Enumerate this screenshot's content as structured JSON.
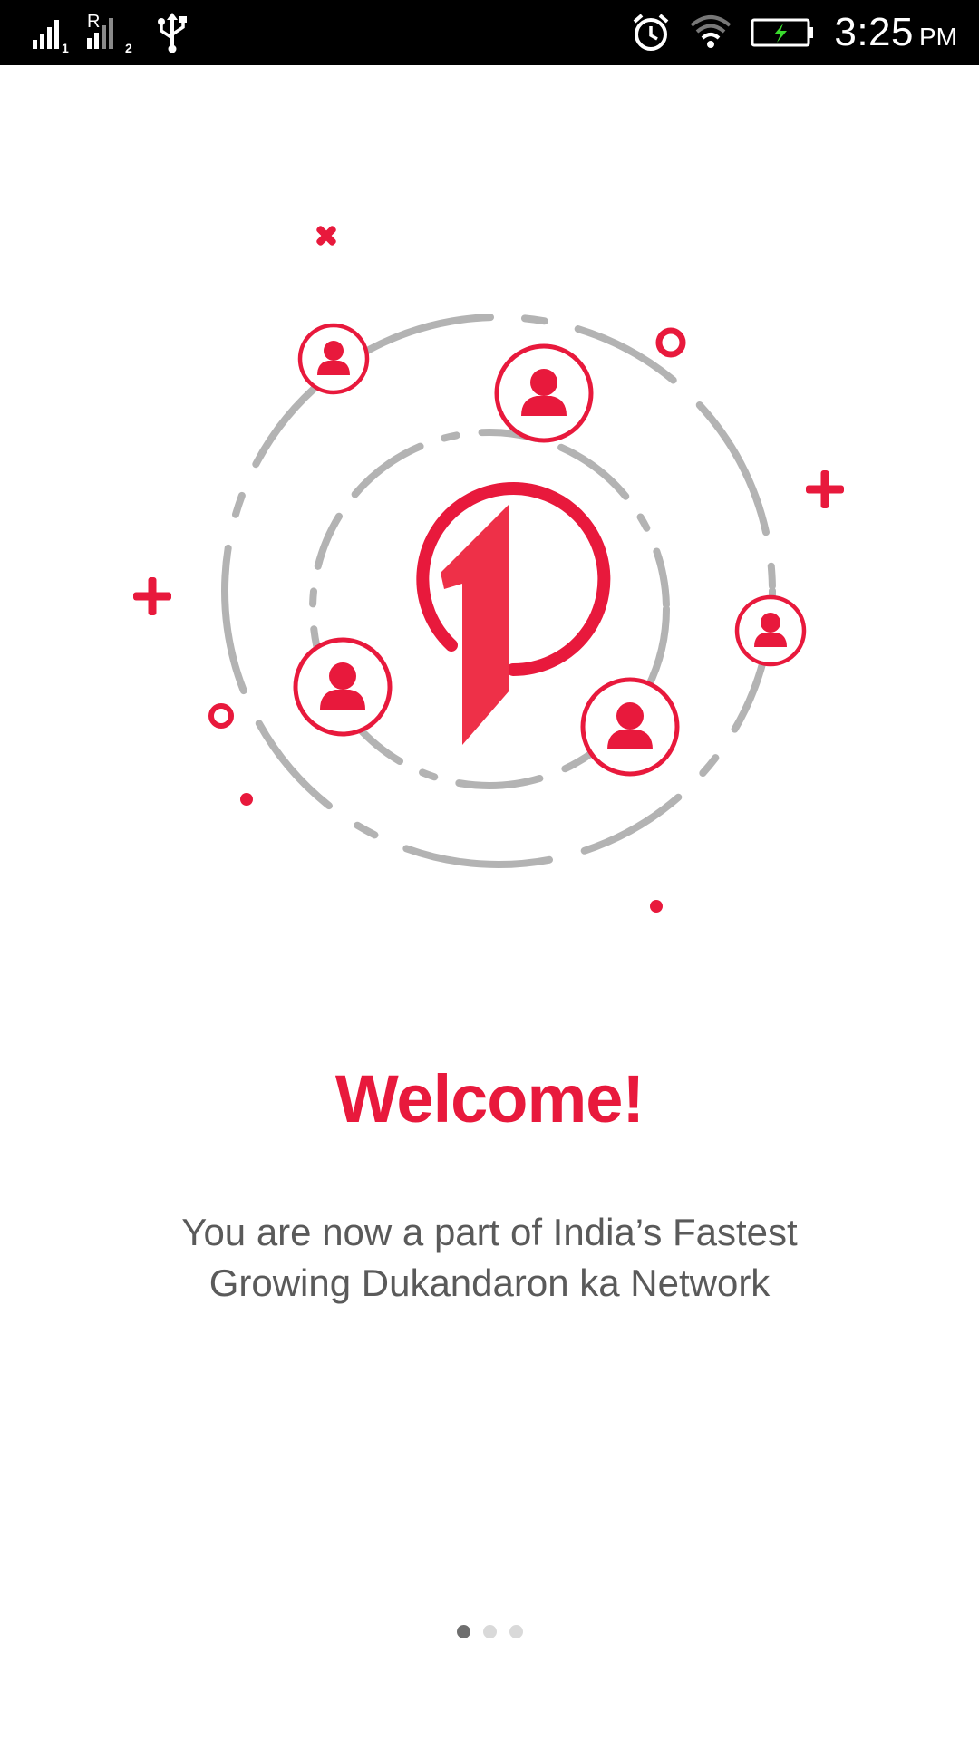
{
  "status_bar": {
    "time": "3:25",
    "ampm": "PM",
    "sim1_label": "1",
    "sim2_roaming": "R",
    "sim2_label": "2",
    "icons": [
      "signal-icon",
      "signal-roaming-icon",
      "usb-icon",
      "alarm-icon",
      "wifi-icon",
      "battery-charging-icon"
    ]
  },
  "illustration": {
    "icons": [
      "network-illustration",
      "logo-icon",
      "user-icon",
      "plus-icon",
      "cross-icon",
      "ring-icon",
      "dot-icon"
    ]
  },
  "welcome": {
    "title": "Welcome!",
    "subtitle_line1": "You are now a part of India’s Fastest",
    "subtitle_line2": "Growing Dukandaron ka Network"
  },
  "pager": {
    "total": 3,
    "active_index": 0
  },
  "colors": {
    "accent": "#e8193c",
    "text_gray": "#5a5a5a",
    "ring_gray": "#b3b3b3",
    "status_bar": "#000000"
  }
}
